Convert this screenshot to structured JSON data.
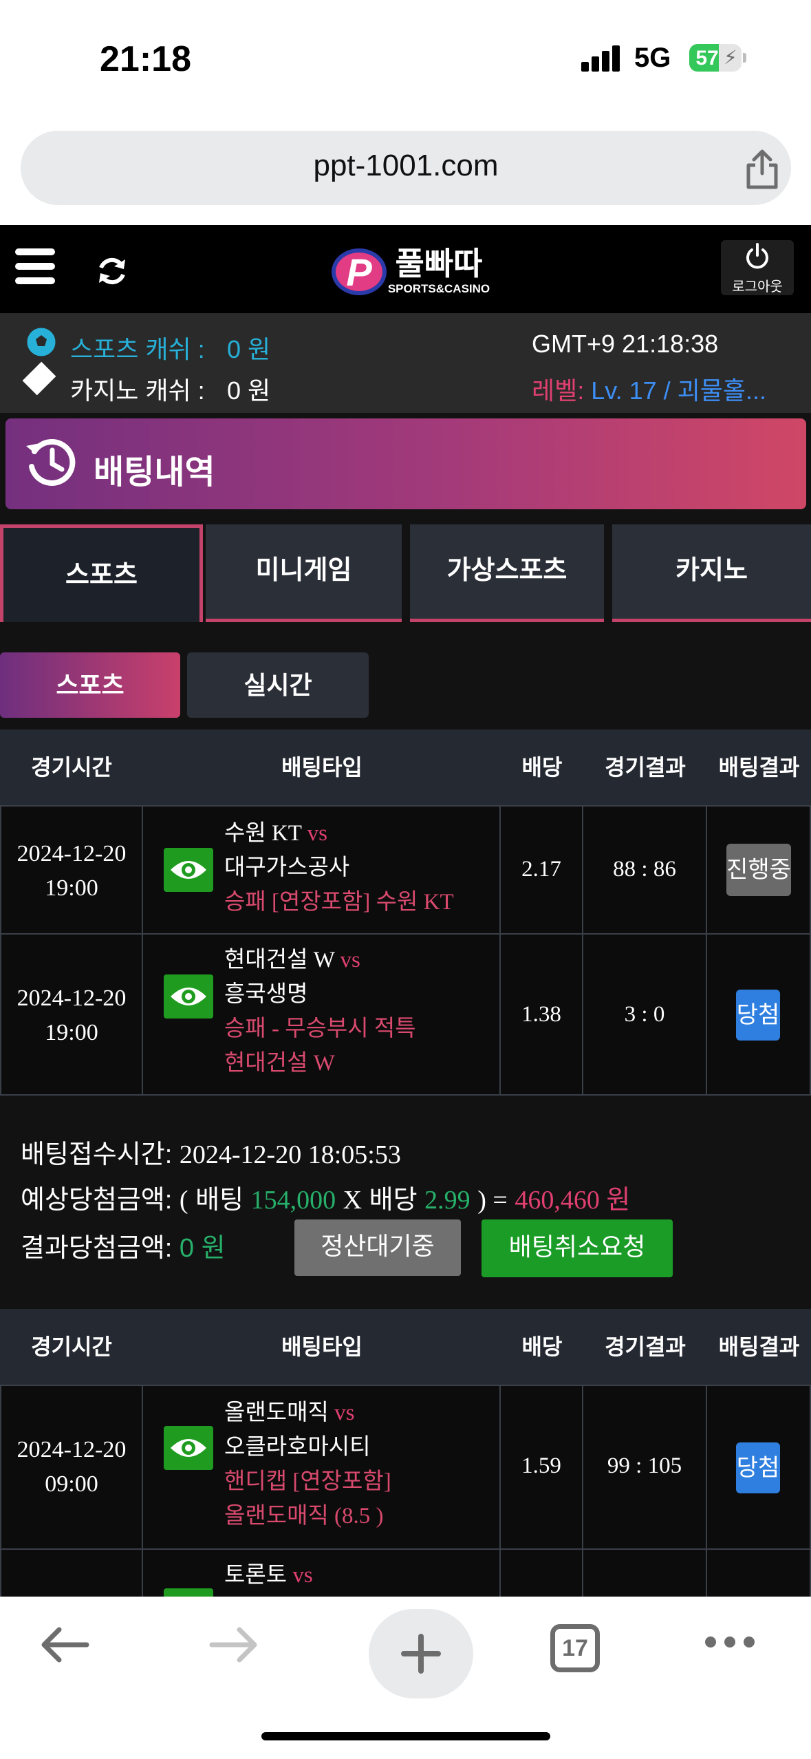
{
  "status_bar": {
    "time": "21:18",
    "network": "5G",
    "battery": "57",
    "battery_level_percent": 57
  },
  "browser": {
    "url": "ppt-1001.com",
    "tab_count": "17"
  },
  "header": {
    "logo_text": "풀빠따",
    "logo_subtext": "SPORTS&CASINO",
    "logout_label": "로그아웃"
  },
  "info": {
    "sports_cash_label": "스포츠 캐쉬 :",
    "sports_cash_value": "0 원",
    "casino_cash_label": "카지노 캐쉬 :",
    "casino_cash_value": "0 원",
    "clock": "GMT+9 21:18:38",
    "level_label": "레벨:",
    "level_value": "Lv. 17 / 괴물홀..."
  },
  "page": {
    "title": "배팅내역"
  },
  "tabs": [
    {
      "label": "스포츠"
    },
    {
      "label": "미니게임"
    },
    {
      "label": "가상스포츠"
    },
    {
      "label": "카지노"
    }
  ],
  "subtabs": [
    {
      "label": "스포츠"
    },
    {
      "label": "실시간"
    }
  ],
  "table_headers": [
    "경기시간",
    "배팅타입",
    "배당",
    "경기결과",
    "배팅결과"
  ],
  "bet1": {
    "rows": [
      {
        "date": "2024-12-20",
        "time": "19:00",
        "home": "수원 KT",
        "vs": "vs",
        "away": "대구가스공사",
        "pick1": "승패 [연장포함] 수원 KT",
        "pick2": "",
        "odds": "2.17",
        "score": "88 : 86",
        "result": "진행중"
      },
      {
        "date": "2024-12-20",
        "time": "19:00",
        "home": "현대건설 W",
        "vs": "vs",
        "away": "흥국생명",
        "pick1": "승패 - 무승부시 적특",
        "pick2": "현대건설 W",
        "odds": "1.38",
        "score": "3 : 0",
        "result": "당첨"
      }
    ],
    "summary": {
      "time_label": "배팅접수시간:",
      "time_value": "2024-12-20 18:05:53",
      "expected_label": "예상당첨금액:",
      "open": "(",
      "bet_label": "배팅",
      "bet_amount": "154,000",
      "x": "X",
      "odds_label": "배당",
      "total_odds": "2.99",
      "close_eq": ") =",
      "expected_amount": "460,460 원",
      "actual_label": "결과당첨금액:",
      "actual_amount": "0 원",
      "wait_button": "정산대기중",
      "cancel_button": "배팅취소요청"
    }
  },
  "bet2": {
    "rows": [
      {
        "date": "2024-12-20",
        "time": "09:00",
        "home": "올랜도매직",
        "vs": "vs",
        "away": "오클라호마시티",
        "pick1": "핸디캡 [연장포함]",
        "pick2": "올랜도매직 (8.5 )",
        "odds": "1.59",
        "score": "99 : 105",
        "result": "당첨"
      },
      {
        "home": "토론토",
        "vs": "vs"
      }
    ]
  },
  "colors": {
    "accent_pink": "#c4436b",
    "accent_blue": "#3d8ef5",
    "win_badge": "#2f7fe0",
    "pending_badge": "#6a6a6a",
    "green": "#1b9c27"
  },
  "icons": [
    "hamburger-icon",
    "refresh-icon",
    "power-icon",
    "soccer-ball-icon",
    "diamond-icon",
    "history-clock-icon",
    "eye-icon",
    "share-icon",
    "back-arrow-icon",
    "forward-arrow-icon",
    "plus-icon",
    "more-icon"
  ]
}
